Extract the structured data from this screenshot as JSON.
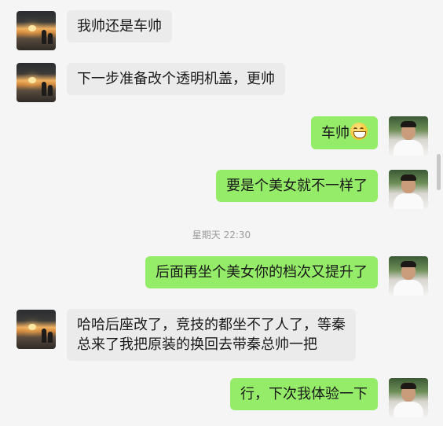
{
  "messages": [
    {
      "side": "in",
      "text": "我帅还是车帅"
    },
    {
      "side": "in",
      "text": "下一步准备改个透明机盖，更帅"
    },
    {
      "side": "out",
      "text": "车帅",
      "emoji": "grinning-face-icon"
    },
    {
      "side": "out",
      "text": "要是个美女就不一样了"
    },
    {
      "side": "out",
      "text": "后面再坐个美女你的档次又提升了"
    },
    {
      "side": "in",
      "text": "哈哈后座改了，竞技的都坐不了人了，等秦总来了我把原装的换回去带秦总帅一把"
    },
    {
      "side": "out",
      "text": "行，下次我体验一下"
    }
  ],
  "timestamp": "星期天 22:30",
  "colors": {
    "background": "#f5f5f5",
    "incoming_bubble": "#ebebeb",
    "outgoing_bubble": "#95ec69",
    "timestamp_text": "#9b9b9b"
  }
}
